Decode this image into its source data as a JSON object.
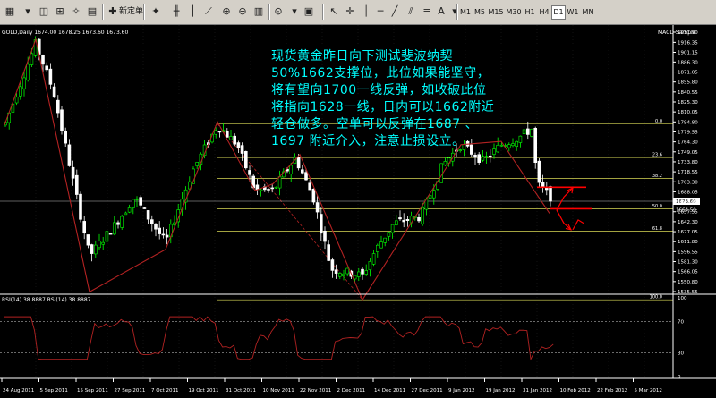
{
  "toolbar": {
    "new_order_label": "新定单",
    "timeframes": [
      "M1",
      "M5",
      "M15",
      "M30",
      "H1",
      "H4",
      "D1",
      "W1",
      "MN"
    ],
    "active_timeframe": "D1"
  },
  "chart": {
    "symbol_label": "GOLD,Daily  1674.00 1678.25 1673.60 1673.60",
    "indicator_label": "MACD Sample",
    "annotation": "现货黄金昨日向下测试斐波纳契50%1662支撑位，此位如果能坚守，将有望向1700一线反弹，如收破此位将指向1628一线，日内可以1662附近轻仓做多。空单可以反弹在1687 、1697 附近介入，注意止损设立。",
    "price_axis": [
      "1931.90",
      "1916.35",
      "1901.15",
      "1886.30",
      "1871.05",
      "1855.80",
      "1840.55",
      "1825.30",
      "1810.05",
      "1794.80",
      "1779.55",
      "1764.30",
      "1749.05",
      "1733.80",
      "1718.55",
      "1703.30",
      "1688.05",
      "1672.80",
      "1657.55",
      "1642.30",
      "1627.05",
      "1611.80",
      "1596.55",
      "1581.30",
      "1566.05",
      "1550.80",
      "1535.55"
    ],
    "current_price": "1673.60",
    "price_tag_2": "1664.50",
    "fib_levels": [
      {
        "label": "0.0",
        "price": 1791.7
      },
      {
        "label": "23.6",
        "price": 1740.3
      },
      {
        "label": "38.2",
        "price": 1708.4
      },
      {
        "label": "50.0",
        "price": 1662.0
      },
      {
        "label": "61.8",
        "price": 1628.0
      },
      {
        "label": "100.0",
        "price": 1523.0
      }
    ],
    "rsi_label": "RSI(14) 38.8887  RSI(14) 38.8887",
    "rsi_value": 38.8887,
    "rsi_levels": [
      70,
      30
    ],
    "rsi_axis": [
      "100",
      "70",
      "30",
      "0"
    ],
    "dates": [
      "24 Aug 2011",
      "5 Sep 2011",
      "15 Sep 2011",
      "27 Sep 2011",
      "7 Oct 2011",
      "19 Oct 2011",
      "31 Oct 2011",
      "10 Nov 2011",
      "22 Nov 2011",
      "2 Dec 2011",
      "14 Dec 2011",
      "27 Dec 2011",
      "9 Jan 2012",
      "19 Jan 2012",
      "31 Jan 2012",
      "10 Feb 2012",
      "22 Feb 2012",
      "5 Mar 2012"
    ],
    "colors": {
      "background": "#000000",
      "bull": "#00ff00",
      "bear": "#ffffff",
      "zigzag": "#b22222",
      "fib": "#ffff66",
      "annotation": "#00ffff",
      "arrow": "#ff0000"
    }
  }
}
